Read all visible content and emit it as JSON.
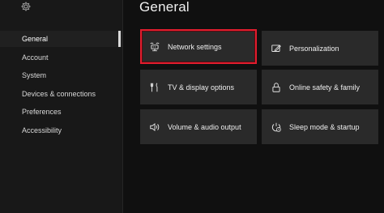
{
  "header": {
    "title": "General"
  },
  "sidebar": {
    "items": [
      {
        "label": "General"
      },
      {
        "label": "Account"
      },
      {
        "label": "System"
      },
      {
        "label": "Devices & connections"
      },
      {
        "label": "Preferences"
      },
      {
        "label": "Accessibility"
      }
    ],
    "selected": "General"
  },
  "tiles": [
    {
      "label": "Network settings",
      "icon": "network-icon",
      "focused": true
    },
    {
      "label": "Personalization",
      "icon": "personalization-icon"
    },
    {
      "label": "TV & display options",
      "icon": "tv-display-icon"
    },
    {
      "label": "Online safety & family",
      "icon": "lock-icon"
    },
    {
      "label": "Volume & audio output",
      "icon": "speaker-icon"
    },
    {
      "label": "Sleep mode & startup",
      "icon": "power-clock-icon"
    }
  ],
  "colors": {
    "focus": "#e11d2e",
    "tile": "#2a2a2a",
    "background": "#101010"
  }
}
